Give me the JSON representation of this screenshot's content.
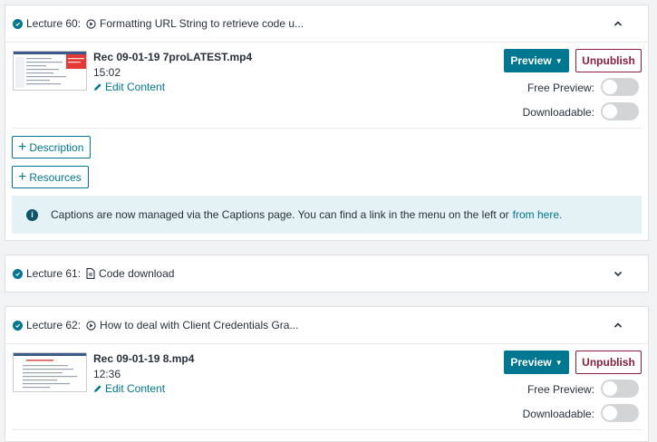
{
  "lectures": [
    {
      "number_label": "Lecture 60:",
      "title": "Formatting URL String to retrieve code u...",
      "type_icon": "play-circle-icon",
      "expanded": true,
      "file_name": "Rec 09-01-19 7proLATEST.mp4",
      "duration": "15:02",
      "edit_label": "Edit Content",
      "preview_label": "Preview",
      "unpublish_label": "Unpublish",
      "free_preview_label": "Free Preview:",
      "downloadable_label": "Downloadable:",
      "description_label": "Description",
      "resources_label": "Resources",
      "info_text": "Captions are now managed via the Captions page. You can find a link in the menu on the left or",
      "info_link": "from here."
    },
    {
      "number_label": "Lecture 61:",
      "title": "Code download",
      "type_icon": "file-icon",
      "expanded": false
    },
    {
      "number_label": "Lecture 62:",
      "title": "How to deal with Client Credentials Gra...",
      "type_icon": "play-circle-icon",
      "expanded": true,
      "file_name": "Rec 09-01-19 8.mp4",
      "duration": "12:36",
      "edit_label": "Edit Content",
      "preview_label": "Preview",
      "unpublish_label": "Unpublish",
      "free_preview_label": "Free Preview:",
      "downloadable_label": "Downloadable:"
    }
  ],
  "colors": {
    "accent": "#007791",
    "unpublish": "#8b1f3d",
    "info_bg": "#e4f1f5",
    "toggle_off": "#d2d4d6"
  }
}
